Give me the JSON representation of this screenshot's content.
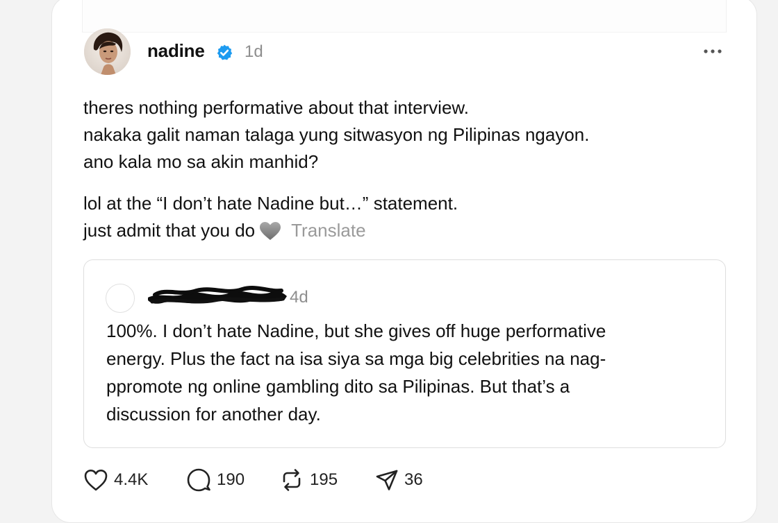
{
  "post": {
    "author": {
      "username": "nadine",
      "verified": true,
      "avatar": "profile-photo"
    },
    "time": "1d",
    "paragraphs": [
      [
        "theres nothing performative about that interview.",
        "nakaka galit naman talaga yung sitwasyon ng Pilipinas ngayon.",
        "ano kala mo sa akin manhid?"
      ],
      [
        "lol at the “I don’t hate Nadine but…” statement.",
        "just admit that you do"
      ]
    ],
    "heart_emoji": "grey-heart",
    "translate_label": "Translate",
    "quoted": {
      "username_redacted": true,
      "time": "4d",
      "lines": [
        "100%. I don’t hate Nadine, but she gives off huge performative",
        "energy. Plus the fact na isa siya sa mga big celebrities na nag-",
        "ppromote ng online gambling dito sa Pilipinas. But that’s a",
        "discussion for another day."
      ]
    },
    "actions": {
      "likes": "4.4K",
      "replies": "190",
      "reposts": "195",
      "shares": "36"
    }
  },
  "icons": {
    "like": "heart-outline-icon",
    "reply": "speech-bubble-icon",
    "repost": "repost-arrows-icon",
    "share": "paper-plane-icon",
    "more": "ellipsis-icon",
    "verified": "verified-badge-icon"
  },
  "colors": {
    "verified": "#1d9bf0",
    "muted": "#8e8e8e",
    "text": "#111111"
  }
}
